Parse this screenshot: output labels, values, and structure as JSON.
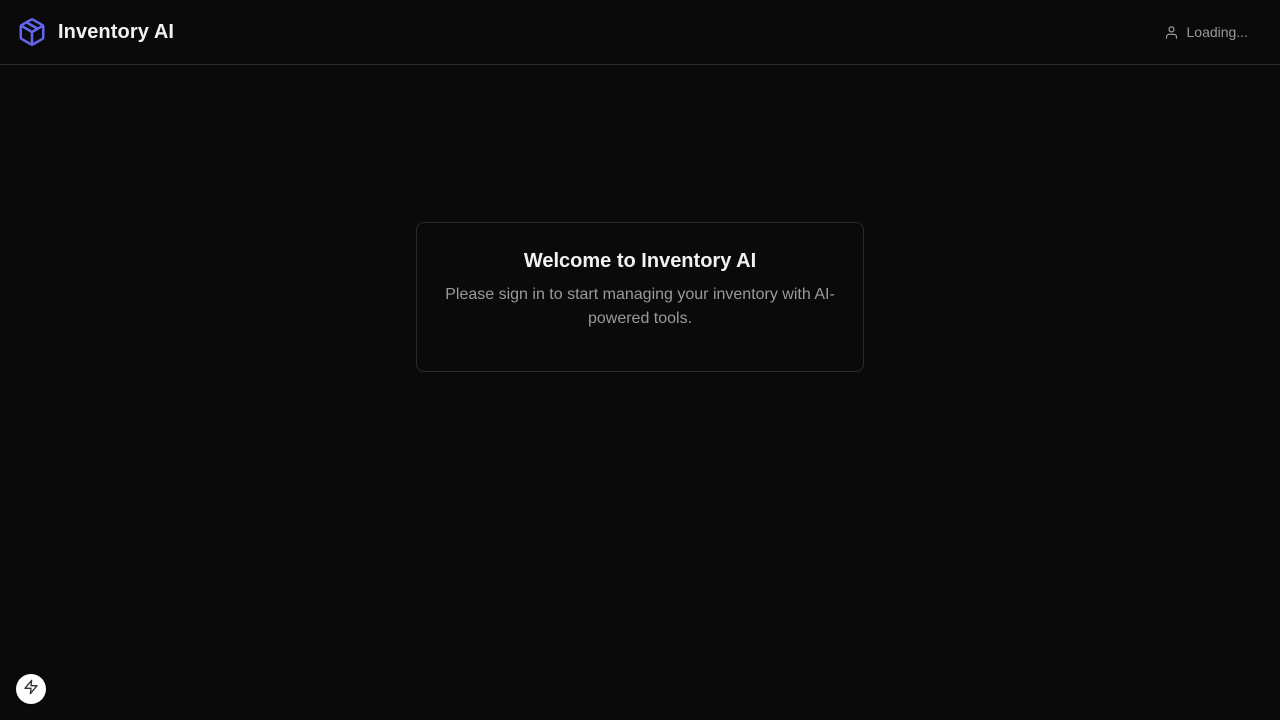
{
  "header": {
    "app_name": "Inventory AI",
    "logo_icon": "package-icon",
    "user_icon": "user-icon",
    "user_status": "Loading..."
  },
  "welcome_card": {
    "title": "Welcome to Inventory AI",
    "description": "Please sign in to start managing your inventory with AI-powered tools."
  },
  "floating_button": {
    "icon": "lightning-bolt-icon"
  },
  "colors": {
    "background": "#0a0a0a",
    "border": "#2a2a2a",
    "accent": "#6366f1",
    "text_primary": "#f2f2f2",
    "text_muted": "#9a9a9a"
  }
}
